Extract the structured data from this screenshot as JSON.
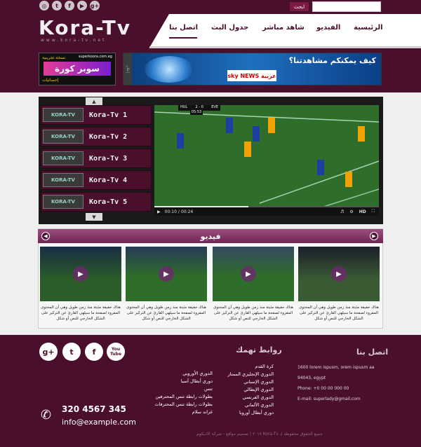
{
  "header": {
    "social": [
      "rss-icon",
      "twitter-icon",
      "facebook-icon",
      "youtube-icon",
      "google-plus-icon"
    ],
    "social_glyphs": [
      "◎",
      "t",
      "f",
      "▶",
      "g+"
    ],
    "search_button": "ابحث",
    "search_placeholder": "",
    "logo": "Kora-Tv",
    "logo_sub": "www.kora-tv.net",
    "nav": [
      {
        "label": "الرئيسية"
      },
      {
        "label": "الفيديو"
      },
      {
        "label": "شاهد مباشر"
      },
      {
        "label": "جدول البث"
      },
      {
        "label": "اتصل بنا"
      }
    ]
  },
  "ads": {
    "left": {
      "site": "superkoora.com.eg",
      "tag": "نسخة تجريبية",
      "brand": "سوبر كورة",
      "sub": "إحصائيات"
    },
    "right": {
      "headline": "كيف يمكنكم مشاهدتنا؟",
      "brand": "sky NEWS عربية",
      "side_tag": "إعلان"
    }
  },
  "channels": {
    "logo_text": "KORA-TV",
    "items": [
      "Kora-Tv 1",
      "Kora-Tv 2",
      "Kora-Tv 3",
      "Kora-Tv 4",
      "Kora-Tv 5"
    ],
    "up_arrow": "▲",
    "down_arrow": "▼"
  },
  "player": {
    "score_home": "HUL",
    "score": "2 - 0",
    "score_away": "EVE",
    "clock": "05:53",
    "time_current": "00:10",
    "time_total": "00:24",
    "progress": 0.42,
    "hd_label": "HD"
  },
  "videos": {
    "title": "فيديو",
    "prev": "◀",
    "next": "▶",
    "caption": "هناك حقيقة مثبتة منذ زمن طويل وهي أن المحتوى المقروء لصفحة ما سيلهي القارئ عن التركيز على الشكل الخارجي للنص أو شكل",
    "count": 4
  },
  "footer": {
    "social": [
      "g+",
      "t",
      "f",
      "You Tube"
    ],
    "contact_title": "اتصل بنا",
    "contact_address": "1600 lorem ispusm, orem ispusm aa 94043, egypt",
    "contact_phone": "Phone: +0 00 00 000 00",
    "contact_email": "E-mail: superlady@gmail.com",
    "links_title": "روابط تهمك",
    "links_col1": [
      "كرة القدم",
      "الدوري الإنجليزي الممتاز",
      "الدوري الإسباني",
      "الدوري الإيطالي",
      "الدوري الفرنسي",
      "الدوري الألماني",
      "دوري أبطال أوروبا"
    ],
    "links_col2": [
      "الدوري الأوروبي",
      "دوري أبطال آسيا",
      "تنس",
      "بطولات رابطة تنس المحترفين",
      "بطولات رابطة تنس المحترفات",
      "غراند سلام"
    ],
    "big_phone": "320 4567 345",
    "big_email": "info@example.com",
    "copyright": "جميع الحقوق محفوظة لـ Kora-Tv ٢٠١٧ | تصميم مواقع - شركة الاديكوم"
  },
  "colors": {
    "brand": "#4a0f2d",
    "accent": "#7a1a45"
  }
}
